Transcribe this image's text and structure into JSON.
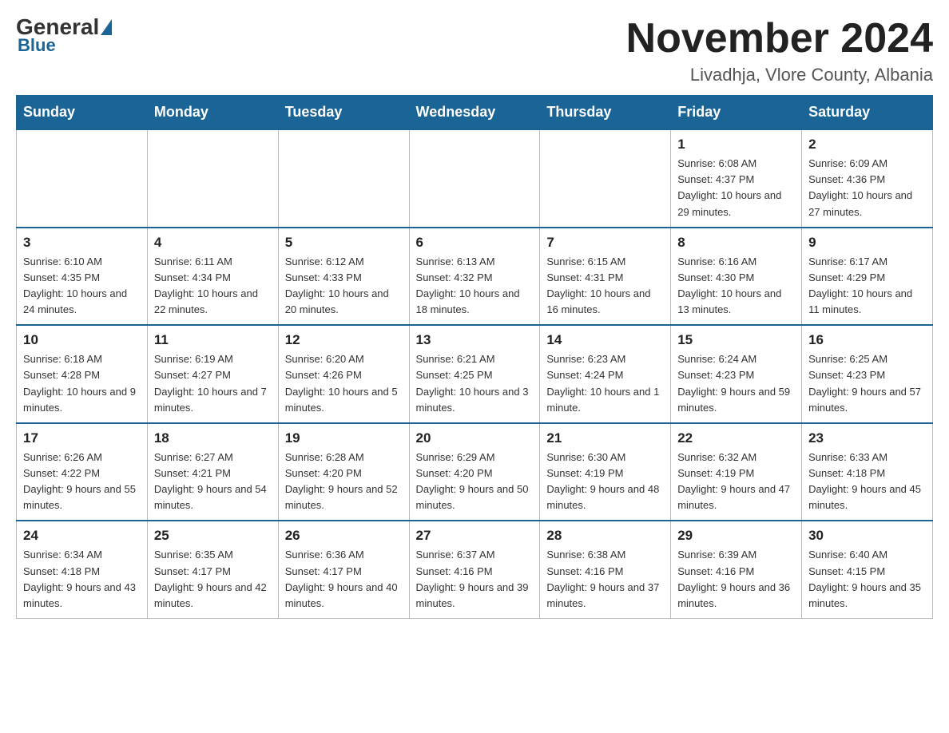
{
  "logo": {
    "general": "General",
    "blue": "Blue"
  },
  "header": {
    "month_title": "November 2024",
    "location": "Livadhja, Vlore County, Albania"
  },
  "weekdays": [
    "Sunday",
    "Monday",
    "Tuesday",
    "Wednesday",
    "Thursday",
    "Friday",
    "Saturday"
  ],
  "weeks": [
    [
      {
        "day": "",
        "info": ""
      },
      {
        "day": "",
        "info": ""
      },
      {
        "day": "",
        "info": ""
      },
      {
        "day": "",
        "info": ""
      },
      {
        "day": "",
        "info": ""
      },
      {
        "day": "1",
        "info": "Sunrise: 6:08 AM\nSunset: 4:37 PM\nDaylight: 10 hours and 29 minutes."
      },
      {
        "day": "2",
        "info": "Sunrise: 6:09 AM\nSunset: 4:36 PM\nDaylight: 10 hours and 27 minutes."
      }
    ],
    [
      {
        "day": "3",
        "info": "Sunrise: 6:10 AM\nSunset: 4:35 PM\nDaylight: 10 hours and 24 minutes."
      },
      {
        "day": "4",
        "info": "Sunrise: 6:11 AM\nSunset: 4:34 PM\nDaylight: 10 hours and 22 minutes."
      },
      {
        "day": "5",
        "info": "Sunrise: 6:12 AM\nSunset: 4:33 PM\nDaylight: 10 hours and 20 minutes."
      },
      {
        "day": "6",
        "info": "Sunrise: 6:13 AM\nSunset: 4:32 PM\nDaylight: 10 hours and 18 minutes."
      },
      {
        "day": "7",
        "info": "Sunrise: 6:15 AM\nSunset: 4:31 PM\nDaylight: 10 hours and 16 minutes."
      },
      {
        "day": "8",
        "info": "Sunrise: 6:16 AM\nSunset: 4:30 PM\nDaylight: 10 hours and 13 minutes."
      },
      {
        "day": "9",
        "info": "Sunrise: 6:17 AM\nSunset: 4:29 PM\nDaylight: 10 hours and 11 minutes."
      }
    ],
    [
      {
        "day": "10",
        "info": "Sunrise: 6:18 AM\nSunset: 4:28 PM\nDaylight: 10 hours and 9 minutes."
      },
      {
        "day": "11",
        "info": "Sunrise: 6:19 AM\nSunset: 4:27 PM\nDaylight: 10 hours and 7 minutes."
      },
      {
        "day": "12",
        "info": "Sunrise: 6:20 AM\nSunset: 4:26 PM\nDaylight: 10 hours and 5 minutes."
      },
      {
        "day": "13",
        "info": "Sunrise: 6:21 AM\nSunset: 4:25 PM\nDaylight: 10 hours and 3 minutes."
      },
      {
        "day": "14",
        "info": "Sunrise: 6:23 AM\nSunset: 4:24 PM\nDaylight: 10 hours and 1 minute."
      },
      {
        "day": "15",
        "info": "Sunrise: 6:24 AM\nSunset: 4:23 PM\nDaylight: 9 hours and 59 minutes."
      },
      {
        "day": "16",
        "info": "Sunrise: 6:25 AM\nSunset: 4:23 PM\nDaylight: 9 hours and 57 minutes."
      }
    ],
    [
      {
        "day": "17",
        "info": "Sunrise: 6:26 AM\nSunset: 4:22 PM\nDaylight: 9 hours and 55 minutes."
      },
      {
        "day": "18",
        "info": "Sunrise: 6:27 AM\nSunset: 4:21 PM\nDaylight: 9 hours and 54 minutes."
      },
      {
        "day": "19",
        "info": "Sunrise: 6:28 AM\nSunset: 4:20 PM\nDaylight: 9 hours and 52 minutes."
      },
      {
        "day": "20",
        "info": "Sunrise: 6:29 AM\nSunset: 4:20 PM\nDaylight: 9 hours and 50 minutes."
      },
      {
        "day": "21",
        "info": "Sunrise: 6:30 AM\nSunset: 4:19 PM\nDaylight: 9 hours and 48 minutes."
      },
      {
        "day": "22",
        "info": "Sunrise: 6:32 AM\nSunset: 4:19 PM\nDaylight: 9 hours and 47 minutes."
      },
      {
        "day": "23",
        "info": "Sunrise: 6:33 AM\nSunset: 4:18 PM\nDaylight: 9 hours and 45 minutes."
      }
    ],
    [
      {
        "day": "24",
        "info": "Sunrise: 6:34 AM\nSunset: 4:18 PM\nDaylight: 9 hours and 43 minutes."
      },
      {
        "day": "25",
        "info": "Sunrise: 6:35 AM\nSunset: 4:17 PM\nDaylight: 9 hours and 42 minutes."
      },
      {
        "day": "26",
        "info": "Sunrise: 6:36 AM\nSunset: 4:17 PM\nDaylight: 9 hours and 40 minutes."
      },
      {
        "day": "27",
        "info": "Sunrise: 6:37 AM\nSunset: 4:16 PM\nDaylight: 9 hours and 39 minutes."
      },
      {
        "day": "28",
        "info": "Sunrise: 6:38 AM\nSunset: 4:16 PM\nDaylight: 9 hours and 37 minutes."
      },
      {
        "day": "29",
        "info": "Sunrise: 6:39 AM\nSunset: 4:16 PM\nDaylight: 9 hours and 36 minutes."
      },
      {
        "day": "30",
        "info": "Sunrise: 6:40 AM\nSunset: 4:15 PM\nDaylight: 9 hours and 35 minutes."
      }
    ]
  ]
}
